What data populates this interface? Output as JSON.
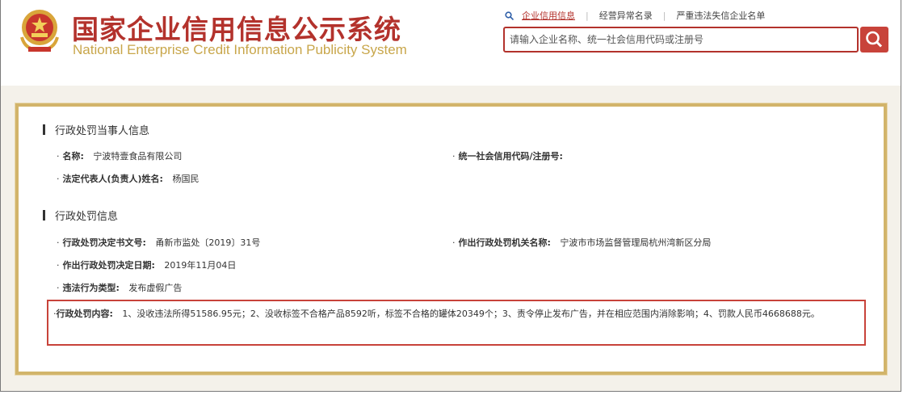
{
  "header": {
    "title_cn": "国家企业信用信息公示系统",
    "title_en": "National Enterprise Credit Information Publicity System",
    "nav": [
      {
        "label": "企业信用信息"
      },
      {
        "label": "经营异常名录"
      },
      {
        "label": "严重违法失信企业名单"
      }
    ],
    "search": {
      "placeholder": "请输入企业名称、统一社会信用代码或注册号"
    }
  },
  "party_section": {
    "heading": "行政处罚当事人信息",
    "name": {
      "label": "名称:",
      "value": "宁波特壹食品有限公司"
    },
    "credit_code": {
      "label": "统一社会信用代码/注册号:",
      "value": ""
    },
    "legal_rep": {
      "label": "法定代表人(负责人)姓名:",
      "value": "杨国民"
    }
  },
  "penalty_section": {
    "heading": "行政处罚信息",
    "doc_no": {
      "label": "行政处罚决定书文号:",
      "value": "甬新市监处〔2019〕31号"
    },
    "authority": {
      "label": "作出行政处罚机关名称:",
      "value": "宁波市市场监督管理局杭州湾新区分局"
    },
    "date": {
      "label": "作出行政处罚决定日期:",
      "value": "2019年11月04日"
    },
    "violation_type": {
      "label": "违法行为类型:",
      "value": "发布虚假广告"
    },
    "content": {
      "label": "行政处罚内容:",
      "value": "1、没收违法所得51586.95元；2、没收标签不合格产品8592听，标签不合格的罐体20349个；3、责令停止发布广告，并在相应范围内消除影响；4、罚款人民币4668688元。"
    }
  },
  "colors": {
    "brand_red": "#b3322c",
    "gold": "#d2b46a"
  }
}
